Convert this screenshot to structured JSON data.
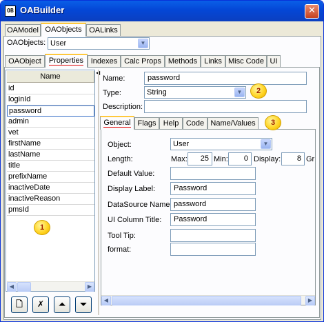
{
  "window": {
    "title": "OABuilder",
    "app_icon": "OB",
    "close_glyph": "✕"
  },
  "top_tabs": [
    {
      "label": "OAModel"
    },
    {
      "label": "OAObjects"
    },
    {
      "label": "OALinks"
    }
  ],
  "object_selector": {
    "label": "OAObjects:",
    "value": "User"
  },
  "sub_tabs": [
    {
      "label": "OAObject"
    },
    {
      "label": "Properties"
    },
    {
      "label": "Indexes"
    },
    {
      "label": "Calc Props"
    },
    {
      "label": "Methods"
    },
    {
      "label": "Links"
    },
    {
      "label": "Misc Code"
    },
    {
      "label": "UI"
    }
  ],
  "properties_list": {
    "header": "Name",
    "items": [
      "id",
      "loginId",
      "password",
      "admin",
      "vet",
      "firstName",
      "lastName",
      "title",
      "prefixName",
      "inactiveDate",
      "inactiveReason",
      "pmsId"
    ],
    "selected": "password"
  },
  "property_form": {
    "name_label": "Name:",
    "name_value": "password",
    "type_label": "Type:",
    "type_value": "String",
    "description_label": "Description:",
    "description_value": ""
  },
  "detail_tabs": [
    {
      "label": "General"
    },
    {
      "label": "Flags"
    },
    {
      "label": "Help"
    },
    {
      "label": "Code"
    },
    {
      "label": "Name/Values"
    }
  ],
  "general": {
    "object_label": "Object:",
    "object_value": "User",
    "length_label": "Length:",
    "max_label": "Max:",
    "max_value": "25",
    "min_label": "Min:",
    "min_value": "0",
    "display_label": "Display:",
    "display_value": "8",
    "gr_label": "Gr",
    "default_value_label": "Default Value:",
    "default_value": "",
    "display_label_label": "Display Label:",
    "display_label_value": "Password",
    "datasource_label": "DataSource Name:",
    "datasource_value": "password",
    "ui_column_label": "UI Column Title:",
    "ui_column_value": "Password",
    "tooltip_label": "Tool Tip:",
    "tooltip_value": "",
    "format_label": "format:",
    "format_value": ""
  },
  "toolbar": {
    "new_glyph": "🗋",
    "delete_glyph": "✗",
    "up_glyph": "⏶",
    "down_glyph": "⏷"
  },
  "badges": [
    "1",
    "2",
    "3"
  ]
}
